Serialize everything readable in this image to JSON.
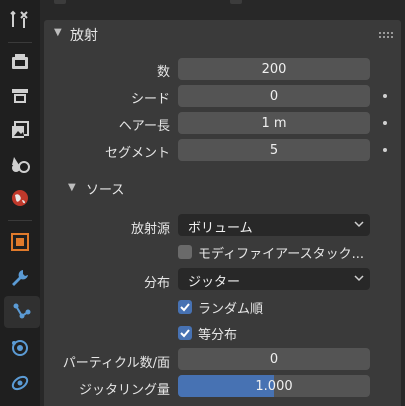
{
  "sidebar": {
    "tabs": [
      {
        "icon": "tool-icon"
      },
      {
        "icon": "render-icon"
      },
      {
        "icon": "output-icon"
      },
      {
        "icon": "view-layer-icon"
      },
      {
        "icon": "scene-icon"
      },
      {
        "icon": "world-icon"
      },
      {
        "icon": "object-icon"
      },
      {
        "icon": "modifier-wrench-icon"
      },
      {
        "icon": "particles-icon",
        "active": true
      },
      {
        "icon": "physics-icon"
      },
      {
        "icon": "constraints-icon"
      }
    ]
  },
  "panel": {
    "title": "放射",
    "fields": [
      {
        "label": "数",
        "value": "200"
      },
      {
        "label": "シード",
        "value": "0"
      },
      {
        "label": "ヘアー長",
        "value": "1 m"
      },
      {
        "label": "セグメント",
        "value": "5"
      }
    ],
    "source": {
      "title": "ソース",
      "emit_from_label": "放射源",
      "emit_from_value": "ボリューム",
      "modifier_stack_label": "モディファイアースタック...",
      "modifier_stack_checked": false,
      "distribution_label": "分布",
      "distribution_value": "ジッター",
      "random_order_label": "ランダム順",
      "random_order_checked": true,
      "even_distribution_label": "等分布",
      "even_distribution_checked": true,
      "particles_per_face_label": "パーティクル数/面",
      "particles_per_face_value": "0",
      "jitter_amount_label": "ジッタリング量",
      "jitter_amount_value": "1.000",
      "jitter_amount_fraction": 0.5
    }
  },
  "colors": {
    "accent": "#4772b3",
    "panel": "#3a3a3a",
    "field": "#545454",
    "background": "#282828"
  }
}
